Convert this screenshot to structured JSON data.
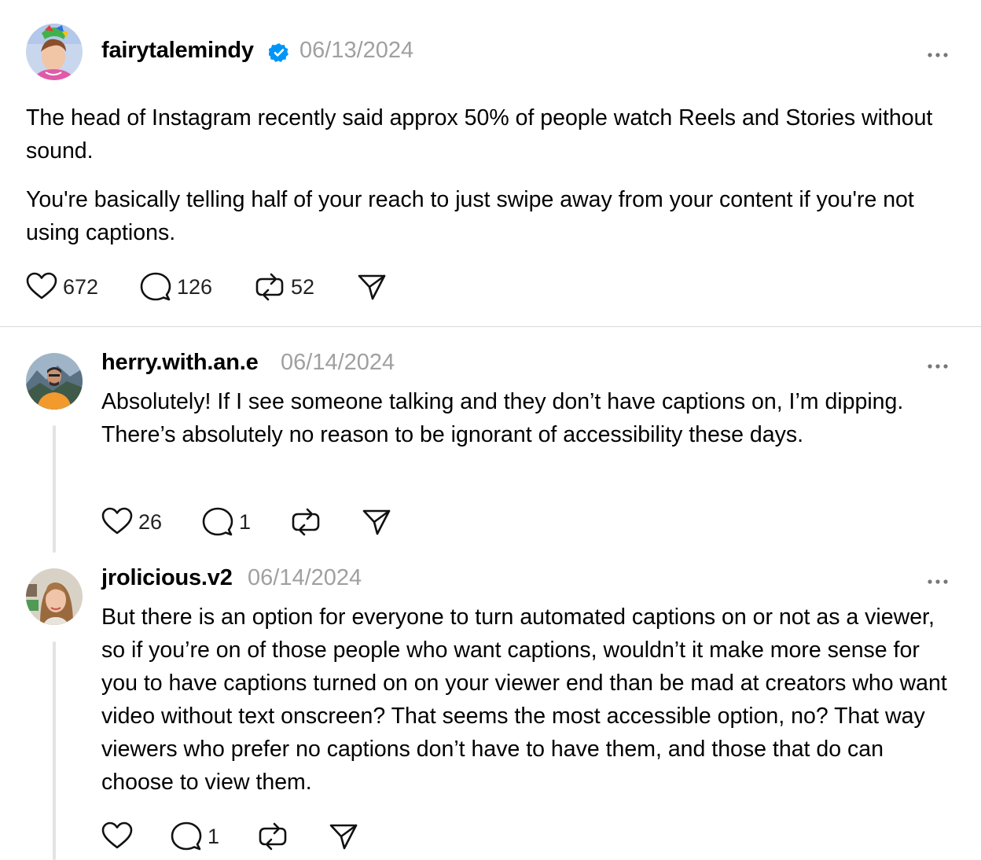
{
  "main_post": {
    "username": "fairytalemindy",
    "verified": true,
    "date": "06/13/2024",
    "paragraphs": [
      "The head of Instagram recently said approx 50% of people watch Reels and Stories without sound.",
      "You're basically telling half of your reach to just swipe away from your content if you're not using captions."
    ],
    "likes": "672",
    "replies": "126",
    "reposts": "52",
    "more_icon": "more-dots-icon",
    "like_icon": "heart-icon",
    "reply_icon": "comment-icon",
    "repost_icon": "repost-icon",
    "share_icon": "send-icon"
  },
  "replies": [
    {
      "username": "herry.with.an.e",
      "date": "06/14/2024",
      "text": "Absolutely! If I see someone talking and they don’t have captions on, I’m dipping. There’s absolutely no reason to be ignorant of accessibility these days.",
      "likes": "26",
      "replies": "1",
      "reposts": ""
    },
    {
      "username": "jrolicious.v2",
      "date": "06/14/2024",
      "text": "But there is an option for everyone to turn automated captions on or not as a viewer, so if you’re on of those people who want captions, wouldn’t it make more sense for you to have captions turned on on your viewer end than be mad at creators who want video without text onscreen? That seems the most accessible option, no? That way viewers who prefer no captions don’t have to have them, and those that do can choose to view them.",
      "likes": "",
      "replies": "1",
      "reposts": ""
    }
  ],
  "colors": {
    "verified_badge": "#0095f6",
    "muted_text": "#a0a0a0",
    "divider": "#d9d9d9",
    "thread_line": "#e3e3e3"
  }
}
